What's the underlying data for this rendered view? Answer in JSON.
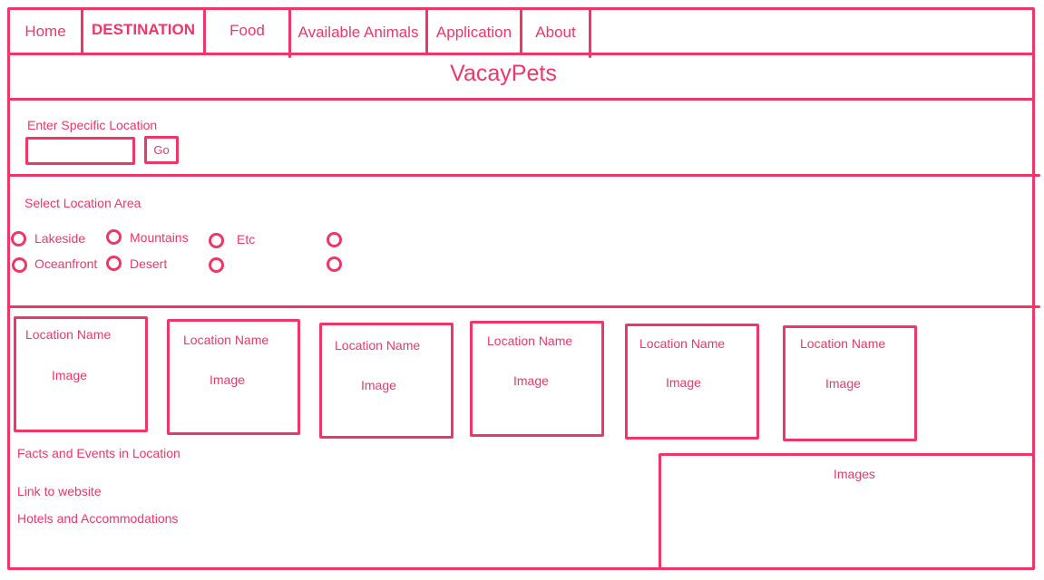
{
  "colors": {
    "accent": "#ee3768",
    "background": "#ffffff"
  },
  "nav": {
    "items": [
      {
        "label": "Home",
        "active": false
      },
      {
        "label": "DESTINATION",
        "active": true
      },
      {
        "label": "Food",
        "active": false
      },
      {
        "label": "Available Animals",
        "active": false
      },
      {
        "label": "Application",
        "active": false
      },
      {
        "label": "About",
        "active": false
      }
    ]
  },
  "header": {
    "title": "VacayPets"
  },
  "search": {
    "label": "Enter Specific Location",
    "value": "",
    "button_label": "Go"
  },
  "area_filter": {
    "label": "Select Location Area",
    "options": [
      {
        "label": "Lakeside",
        "selected": false
      },
      {
        "label": "Mountains",
        "selected": false
      },
      {
        "label": "Etc",
        "selected": false
      },
      {
        "label": "",
        "selected": false
      },
      {
        "label": "Oceanfront",
        "selected": false
      },
      {
        "label": "Desert",
        "selected": false
      },
      {
        "label": "",
        "selected": false
      },
      {
        "label": "",
        "selected": false
      }
    ]
  },
  "locations": [
    {
      "name": "Location Name",
      "image": "Image"
    },
    {
      "name": "Location Name",
      "image": "Image"
    },
    {
      "name": "Location Name",
      "image": "Image"
    },
    {
      "name": "Location Name",
      "image": "Image"
    },
    {
      "name": "Location Name",
      "image": "Image"
    },
    {
      "name": "Location Name",
      "image": "Image"
    }
  ],
  "details": {
    "facts": "Facts and Events in Location",
    "link": "Link to website",
    "hotels": "Hotels and Accommodations",
    "images_label": "Images"
  }
}
